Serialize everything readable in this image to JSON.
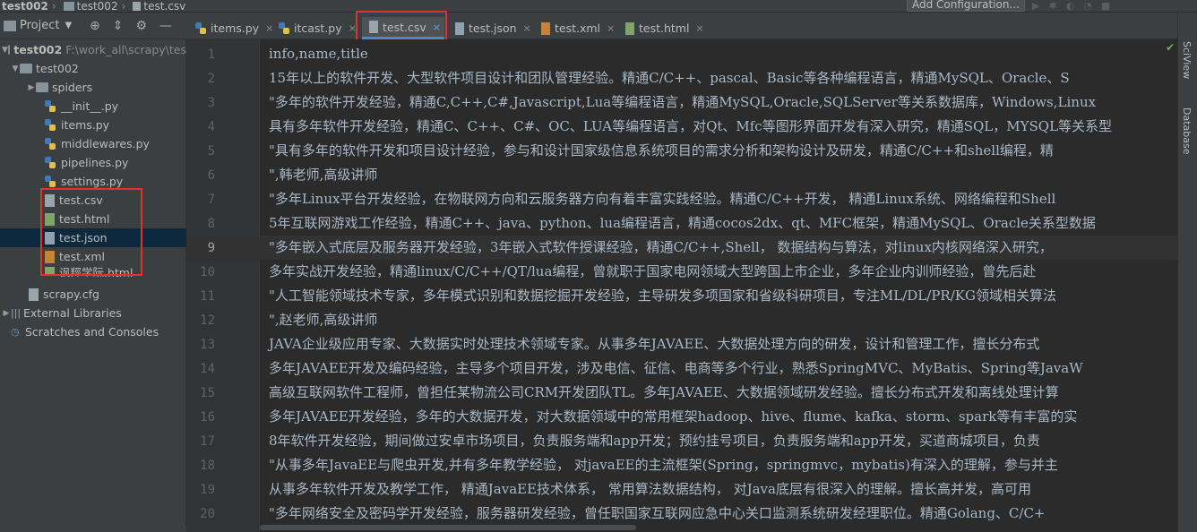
{
  "breadcrumb": [
    "test002",
    "test002",
    "test.csv"
  ],
  "toolbar": {
    "add_configuration": "Add Configuration..."
  },
  "project_panel": {
    "title": "Project"
  },
  "tree": {
    "root": {
      "label": "test002",
      "path": "F:\\work_all\\scrapy\\tes"
    },
    "package": "test002",
    "items": [
      {
        "label": "spiders"
      },
      {
        "label": "__init__.py"
      },
      {
        "label": "items.py"
      },
      {
        "label": "middlewares.py"
      },
      {
        "label": "pipelines.py"
      },
      {
        "label": "settings.py"
      },
      {
        "label": "test.csv"
      },
      {
        "label": "test.html"
      },
      {
        "label": "test.json"
      },
      {
        "label": "test.xml"
      },
      {
        "label": "讽羥学阮.html"
      }
    ],
    "scrapy_cfg": "scrapy.cfg",
    "external_libraries": "External Libraries",
    "scratches": "Scratches and Consoles"
  },
  "tabs": [
    {
      "label": "items.py"
    },
    {
      "label": "itcast.py"
    },
    {
      "label": "test.csv"
    },
    {
      "label": "test.json"
    },
    {
      "label": "test.xml"
    },
    {
      "label": "test.html"
    }
  ],
  "active_tab": "test.csv",
  "right_strip": {
    "sciview": "SciView",
    "database": "Database"
  },
  "editor": {
    "line_numbers": [
      "1",
      "2",
      "3",
      "4",
      "5",
      "6",
      "7",
      "8",
      "9",
      "10",
      "11",
      "12",
      "13",
      "14",
      "15",
      "16",
      "17",
      "18",
      "19",
      "20"
    ],
    "current_line": "9",
    "lines": [
      "info,name,title",
      "15年以上的软件开发、大型软件项目设计和团队管理经验。精通C/C++、pascal、Basic等各种编程语言，精通MySQL、Oracle、S",
      "\"多年的软件开发经验，精通C,C++,C#,Javascript,Lua等编程语言，精通MySQL,Oracle,SQLServer等关系数据库，Windows,Linux",
      "具有多年软件开发经验，精通C、C++、C#、OC、LUA等编程语言，对Qt、Mfc等图形界面开发有深入研究，精通SQL，MYSQL等关系型",
      "\"具有多年的软件开发和项目设计经验，参与和设计国家级信息系统项目的需求分析和架构设计及研发，精通C/C++和shell编程，精",
      "\",韩老师,高级讲师",
      "\"多年Linux平台开发经验，在物联网方向和云服务器方向有着丰富实践经验。精通C/C++开发， 精通Linux系统、网络编程和Shell",
      "5年互联网游戏工作经验，精通C++、java、python、lua编程语言，精通cocos2dx、qt、MFC框架，精通MySQL、Oracle关系型数据",
      "\"多年嵌入式底层及服务器开发经验，3年嵌入式软件授课经验，精通C/C++,Shell， 数据结构与算法，对linux内核网络深入研究，",
      "多年实战开发经验，精通linux/C/C++/QT/lua编程，曾就职于国家电网领域大型跨国上市企业，多年企业内训师经验，曾先后赴",
      "\"人工智能领域技术专家，多年模式识别和数据挖掘开发经验，主导研发多项国家和省级科研项目，专注ML/DL/PR/KG领域相关算法",
      "\",赵老师,高级讲师",
      "JAVA企业级应用专家、大数据实时处理技术领域专家。从事多年JAVAEE、大数据处理方向的研发，设计和管理工作，擅长分布式",
      "多年JAVAEE开发及编码经验，主导多个项目开发，涉及电信、征信、电商等多个行业，熟悉SpringMVC、MyBatis、Spring等JavaW",
      "高级互联网软件工程师，曾担任某物流公司CRM开发团队TL。多年JAVAEE、大数据领域研发经验。擅长分布式开发和离线处理计算",
      "多年JAVAEE开发经验，多年的大数据开发，对大数据领域中的常用框架hadoop、hive、flume、kafka、storm、spark等有丰富的实",
      "8年软件开发经验，期间做过安卓市场项目，负责服务端和app开发；预约挂号项目，负责服务端和app开发，买道商城项目，负责",
      "\"从事多年JavaEE与爬虫开发,并有多年教学经验， 对javaEE的主流框架(Spring，springmvc，mybatis)有深入的理解，参与并主",
      "从事多年软件开发及教学工作， 精通JavaEE技术体系， 常用算法数据结构， 对Java底层有很深入的理解。擅长高并发，高可用",
      "\"多年网络安全及密码学开发经验，服务器研发经验，曾任职国家互联网应急中心关口监测系统研发经理职位。精通Golang、C/C+"
    ]
  }
}
